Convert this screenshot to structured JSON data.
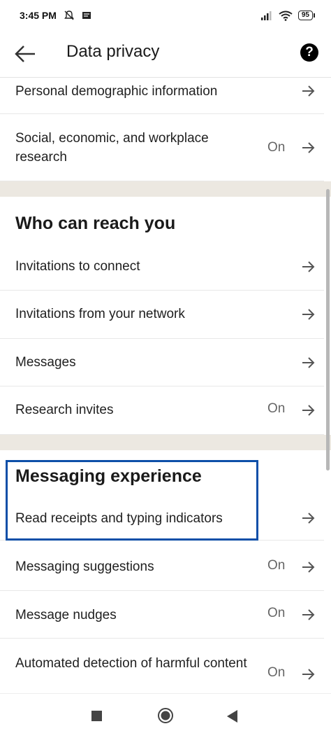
{
  "status_bar": {
    "time": "3:45 PM",
    "battery": "95"
  },
  "header": {
    "title": "Data privacy",
    "help_label": "?"
  },
  "rows_top": [
    {
      "label": "Personal demographic information",
      "state": ""
    },
    {
      "label": "Social, economic, and workplace research",
      "state": "On"
    }
  ],
  "section_reach": {
    "heading": "Who can reach you",
    "rows": [
      {
        "label": "Invitations to connect",
        "state": ""
      },
      {
        "label": "Invitations from your network",
        "state": ""
      },
      {
        "label": "Messages",
        "state": ""
      },
      {
        "label": "Research invites",
        "state": "On"
      }
    ]
  },
  "section_messaging": {
    "heading": "Messaging experience",
    "rows": [
      {
        "label": "Read receipts and typing indicators",
        "state": ""
      },
      {
        "label": "Messaging suggestions",
        "state": "On"
      },
      {
        "label": "Message nudges",
        "state": "On"
      },
      {
        "label": "Automated detection of harmful content",
        "state": "On"
      }
    ]
  },
  "colors": {
    "highlight": "#0d4fa8",
    "divider_band": "#ece8e1"
  },
  "icons": [
    "back-arrow-icon",
    "help-icon",
    "chevron-right-icon",
    "silent-icon",
    "message-icon",
    "signal-icon",
    "wifi-icon",
    "battery-icon"
  ]
}
